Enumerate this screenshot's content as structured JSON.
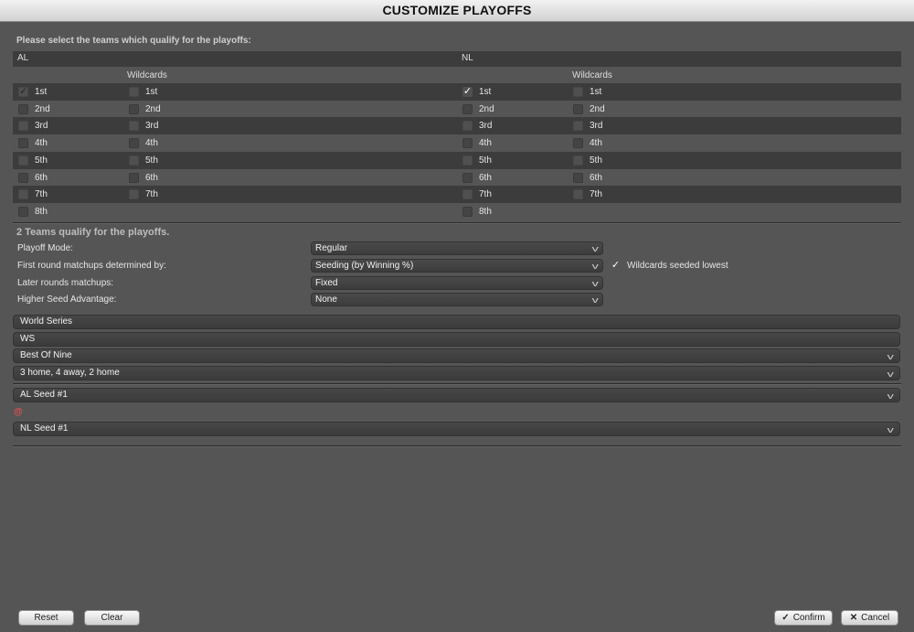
{
  "title": "CUSTOMIZE PLAYOFFS",
  "instruction": "Please select the teams which qualify for the playoffs:",
  "leagues": [
    {
      "name": "AL",
      "wildcards_label": "Wildcards",
      "seeds": [
        {
          "label": "1st",
          "checked": true
        },
        {
          "label": "2nd",
          "checked": false
        },
        {
          "label": "3rd",
          "checked": false
        },
        {
          "label": "4th",
          "checked": false
        },
        {
          "label": "5th",
          "checked": false
        },
        {
          "label": "6th",
          "checked": false
        },
        {
          "label": "7th",
          "checked": false
        },
        {
          "label": "8th",
          "checked": false
        }
      ],
      "wildcards": [
        {
          "label": "1st",
          "checked": false
        },
        {
          "label": "2nd",
          "checked": false
        },
        {
          "label": "3rd",
          "checked": false
        },
        {
          "label": "4th",
          "checked": false
        },
        {
          "label": "5th",
          "checked": false
        },
        {
          "label": "6th",
          "checked": false
        },
        {
          "label": "7th",
          "checked": false
        }
      ]
    },
    {
      "name": "NL",
      "wildcards_label": "Wildcards",
      "seeds": [
        {
          "label": "1st",
          "checked": true
        },
        {
          "label": "2nd",
          "checked": false
        },
        {
          "label": "3rd",
          "checked": false
        },
        {
          "label": "4th",
          "checked": false
        },
        {
          "label": "5th",
          "checked": false
        },
        {
          "label": "6th",
          "checked": false
        },
        {
          "label": "7th",
          "checked": false
        },
        {
          "label": "8th",
          "checked": false
        }
      ],
      "wildcards": [
        {
          "label": "1st",
          "checked": false
        },
        {
          "label": "2nd",
          "checked": false
        },
        {
          "label": "3rd",
          "checked": false
        },
        {
          "label": "4th",
          "checked": false
        },
        {
          "label": "5th",
          "checked": false
        },
        {
          "label": "6th",
          "checked": false
        },
        {
          "label": "7th",
          "checked": false
        }
      ]
    }
  ],
  "qualify_text": "2 Teams qualify for the playoffs.",
  "options": {
    "playoff_mode": {
      "label": "Playoff Mode:",
      "value": "Regular"
    },
    "first_round": {
      "label": "First round matchups determined by:",
      "value": "Seeding (by Winning %)"
    },
    "later_rounds": {
      "label": "Later rounds matchups:",
      "value": "Fixed"
    },
    "higher_seed": {
      "label": "Higher Seed Advantage:",
      "value": "None"
    },
    "wildcards_seeded_lowest": {
      "label": "Wildcards seeded lowest",
      "checked": true
    }
  },
  "series": {
    "name": "World Series",
    "abbr": "WS",
    "length": "Best Of Nine",
    "format": "3 home, 4 away, 2 home"
  },
  "matchup": {
    "team1": "AL Seed #1",
    "separator": "@",
    "team2": "NL Seed #1"
  },
  "buttons": {
    "reset": "Reset",
    "clear": "Clear",
    "confirm": "Confirm",
    "cancel": "Cancel"
  },
  "icons": {
    "check": "check-icon",
    "chevron": "chevron-down-icon",
    "cancel": "x-icon"
  }
}
